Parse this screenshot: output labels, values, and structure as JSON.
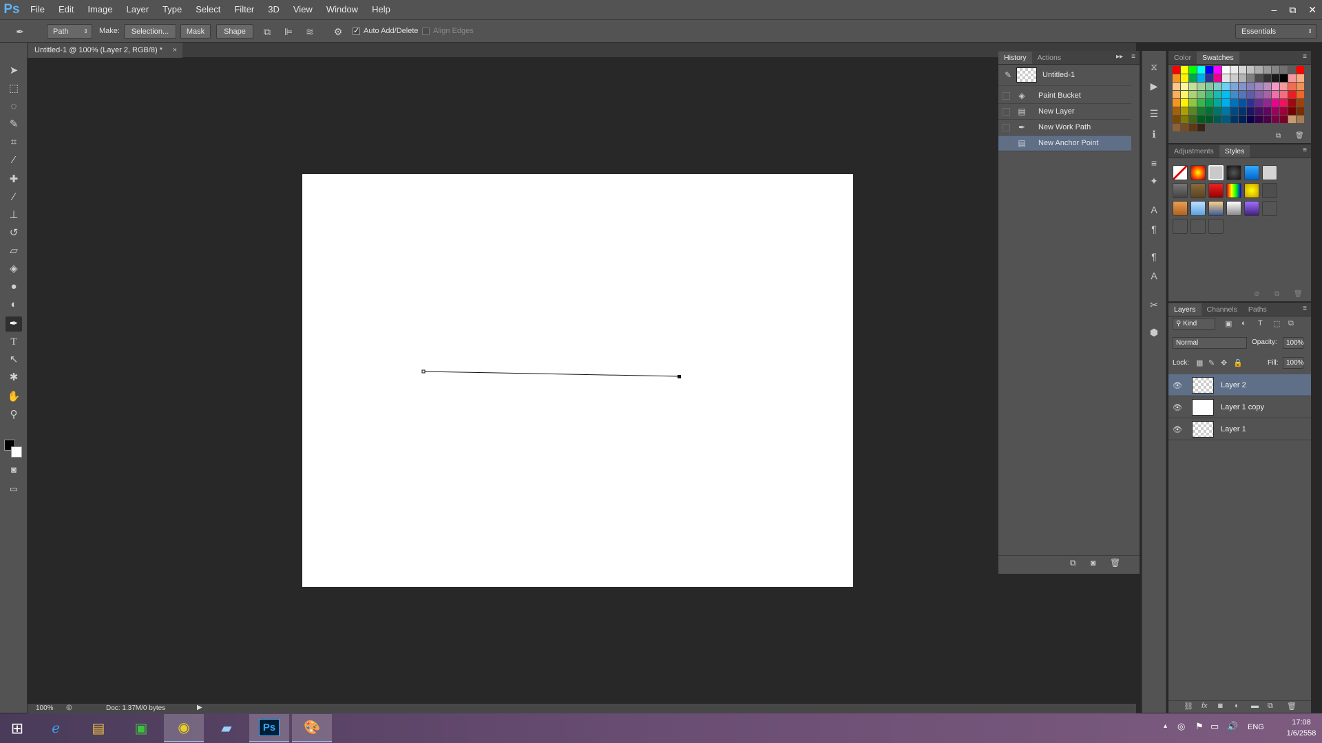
{
  "app": {
    "logo": "Ps"
  },
  "menu": [
    "File",
    "Edit",
    "Image",
    "Layer",
    "Type",
    "Select",
    "Filter",
    "3D",
    "View",
    "Window",
    "Help"
  ],
  "window_controls": {
    "minimize": "–",
    "restore": "⧉",
    "close": "✕"
  },
  "options": {
    "mode_select": "Path",
    "make_label": "Make:",
    "selection_button": "Selection...",
    "mask_button": "Mask",
    "shape_button": "Shape",
    "auto_add_delete": {
      "label": "Auto Add/Delete",
      "checked": true
    },
    "align_edges": {
      "label": "Align Edges",
      "checked": false
    },
    "workspace": "Essentials"
  },
  "document": {
    "tab_title": "Untitled-1 @ 100% (Layer 2, RGB/8) *",
    "zoom": "100%",
    "doc_info": "Doc: 1.37M/0 bytes"
  },
  "history": {
    "tabs": [
      "History",
      "Actions"
    ],
    "snapshot": "Untitled-1",
    "items": [
      {
        "label": "Paint Bucket",
        "icon": "paint-bucket-icon"
      },
      {
        "label": "New Layer",
        "icon": "layer-icon"
      },
      {
        "label": "New Work Path",
        "icon": "pen-icon"
      },
      {
        "label": "New Anchor Point",
        "icon": "pen-icon",
        "selected": true
      }
    ]
  },
  "color_panel": {
    "tabs": [
      "Color",
      "Swatches"
    ]
  },
  "adjust_panel": {
    "tabs": [
      "Adjustments",
      "Styles"
    ]
  },
  "layers_panel": {
    "tabs": [
      "Layers",
      "Channels",
      "Paths"
    ],
    "filter_kind": "Kind",
    "blend_mode": "Normal",
    "opacity_label": "Opacity:",
    "opacity": "100%",
    "lock_label": "Lock:",
    "fill_label": "Fill:",
    "fill": "100%",
    "layers": [
      {
        "name": "Layer 2",
        "selected": true,
        "thumb": "transparent"
      },
      {
        "name": "Layer 1 copy",
        "selected": false,
        "thumb": "white"
      },
      {
        "name": "Layer 1",
        "selected": false,
        "thumb": "transparent"
      }
    ]
  },
  "taskbar": {
    "language": "ENG",
    "time": "17:08",
    "date": "1/6/2558",
    "apps": [
      "internet-explorer-icon",
      "file-explorer-icon",
      "store-icon",
      "chrome-icon",
      "notepad-icon",
      "photoshop-icon",
      "paint-icon"
    ]
  },
  "colors": {
    "selection": "#5e6f87",
    "panel": "#535353",
    "canvas_bg": "#282828"
  }
}
